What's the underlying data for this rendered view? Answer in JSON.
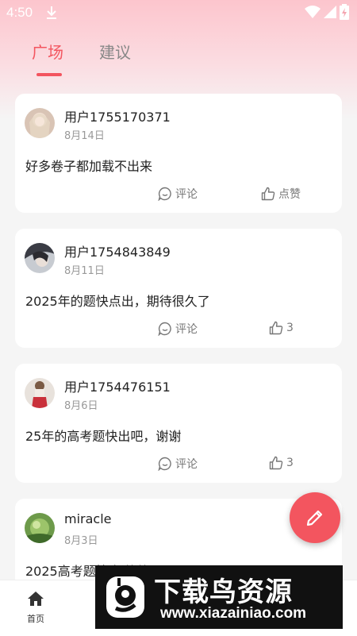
{
  "status_bar": {
    "time": "4:50"
  },
  "tabs": [
    {
      "label": "广场",
      "active": true
    },
    {
      "label": "建议",
      "active": false
    }
  ],
  "posts": [
    {
      "username": "用户1755170371",
      "date": "8月14日",
      "content": "好多卷子都加载不出来",
      "comment_label": "评论",
      "like_label": "点赞"
    },
    {
      "username": "用户1754843849",
      "date": "8月11日",
      "content": "2025年的题快点出，期待很久了",
      "comment_label": "评论",
      "like_label": "3"
    },
    {
      "username": "用户1754476151",
      "date": "8月6日",
      "content": "25年的高考题快出吧，谢谢",
      "comment_label": "评论",
      "like_label": "3"
    },
    {
      "username": "miracle",
      "date": "8月3日",
      "content": "2025高考题快出谢谢"
    }
  ],
  "bottom_nav": {
    "home_label": "首页"
  },
  "watermark": {
    "title": "下载鸟资源",
    "url": "www.xiazainiao.com"
  },
  "colors": {
    "accent": "#f3555f",
    "top_gradient": "#fcc5cd"
  }
}
